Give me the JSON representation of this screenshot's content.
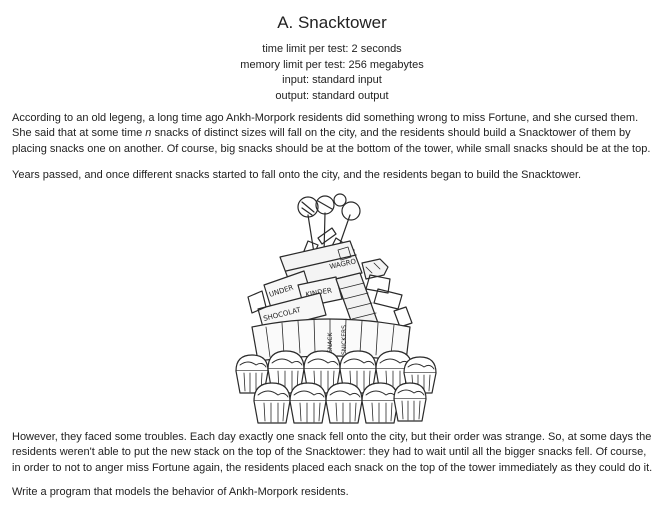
{
  "problem": {
    "title": "A. Snacktower",
    "time_limit": "time limit per test: 2 seconds",
    "memory_limit": "memory limit per test: 256 megabytes",
    "input": "input: standard input",
    "output": "output: standard output"
  },
  "statement": {
    "p1_before": "According to an old legeng, a long time ago Ankh-Morpork residents did something wrong to miss Fortune, and she cursed them. She said that at some time ",
    "p1_var": "n",
    "p1_after": " snacks of distinct sizes will fall on the city, and the residents should build a Snacktower of them by placing snacks one on another. Of course, big snacks should be at the bottom of the tower, while small snacks should be at the top.",
    "p2": "Years passed, and once different snacks started to fall onto the city, and the residents began to build the Snacktower.",
    "p3": "However, they faced some troubles. Each day exactly one snack fell onto the city, but their order was strange. So, at some days the residents weren't able to put the new stack on the top of the Snacktower: they had to wait until all the bigger snacks fell. Of course, in order to not to anger miss Fortune again, the residents placed each snack on the top of the tower immediately as they could do it.",
    "p4": "Write a program that models the behavior of Ankh-Morpork residents."
  },
  "illustration": {
    "labels": [
      "WAGRO",
      "UNDER",
      "KINDER",
      "SHOCOLAT",
      "SNACK",
      "SNICKERS"
    ]
  }
}
